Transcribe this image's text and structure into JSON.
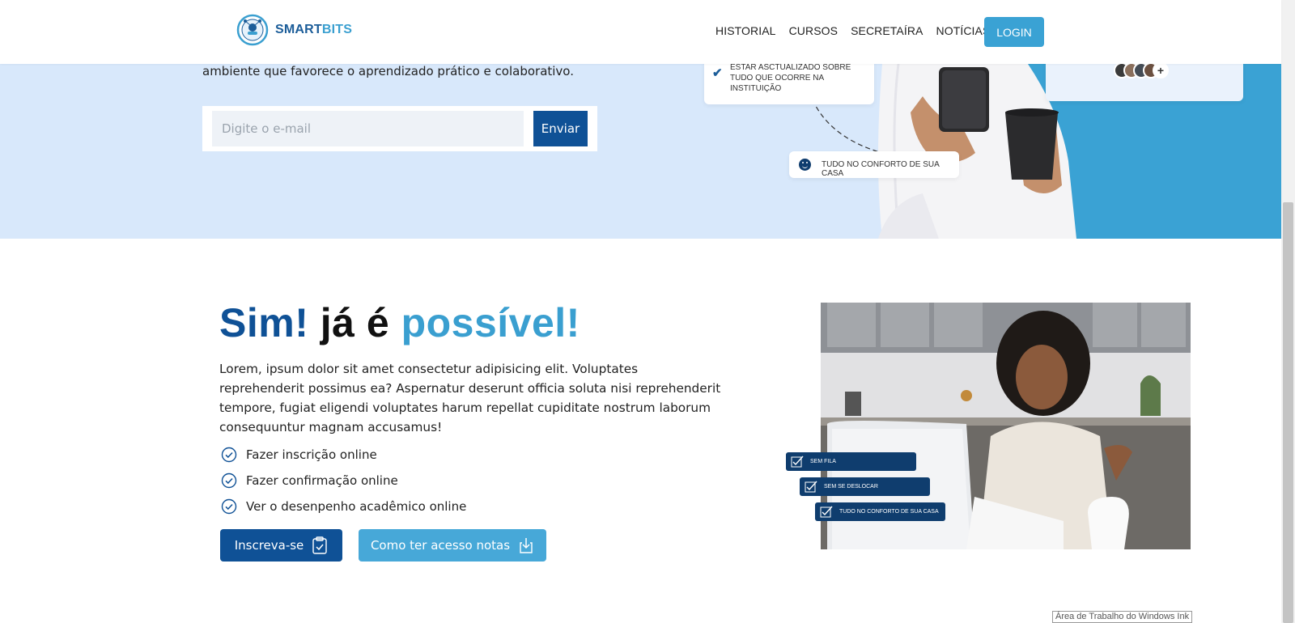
{
  "header": {
    "brand": {
      "part1": "SMART",
      "part2": "BITS",
      "logo_icon": "smartbits-logo"
    },
    "nav": [
      "HISTORIAL",
      "CURSOS",
      "SECRETAÍRA",
      "NOTÍCIAS"
    ],
    "login_label": "LOGIN"
  },
  "hero": {
    "text": "ambiente que favorece o aprendizado prático e colaborativo.",
    "email_placeholder": "Digite o e-mail",
    "send_label": "Enviar",
    "card_update": "ESTAR ASCTUALIZADO SOBRE TUDO QUE OCORRE NA INSTITUIÇÃO",
    "card_comfort": "TUDO NO CONFORTO DE SUA CASA",
    "avatars_more": "+"
  },
  "main": {
    "headline": {
      "part1": "Sim!",
      "part2": "já é",
      "part3": "possível!"
    },
    "paragraph": "Lorem, ipsum dolor sit amet consectetur adipisicing elit. Voluptates reprehenderit possimus ea? Aspernatur deserunt officia soluta nisi reprehenderit tempore, fugiat eligendi voluptates harum repellat cupiditate nostrum laborum consequuntur magnam accusamus!",
    "features": [
      "Fazer inscrição online",
      "Fazer confirmação online",
      "Ver o desenpenho acadêmico online"
    ],
    "signup_label": "Inscreva-se",
    "notes_label": "Como ter acesso notas"
  },
  "photo_tags": [
    "SEM FILA",
    "SEM SE DESLOCAR",
    "TUDO NO CONFORTO DE SUA CASA"
  ],
  "system": {
    "tooltip": "Área de Trabalho do Windows Ink"
  },
  "colors": {
    "primary": "#0f5196",
    "accent": "#3aa2d4",
    "hero_bg": "#d8e8fb"
  }
}
